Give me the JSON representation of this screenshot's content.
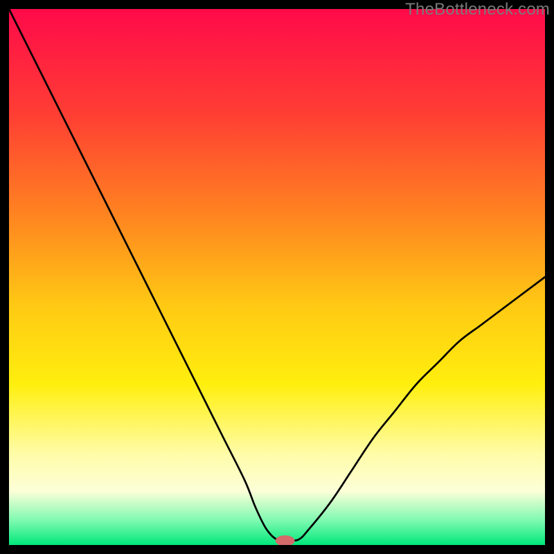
{
  "watermark": "TheBottleneck.com",
  "chart_data": {
    "type": "line",
    "title": "",
    "xlabel": "",
    "ylabel": "",
    "xlim": [
      0,
      100
    ],
    "ylim": [
      0,
      100
    ],
    "gradient_stops": [
      {
        "t": 0.0,
        "color": "#ff0a4a"
      },
      {
        "t": 0.2,
        "color": "#ff3f33"
      },
      {
        "t": 0.4,
        "color": "#ff8a1f"
      },
      {
        "t": 0.55,
        "color": "#ffc814"
      },
      {
        "t": 0.7,
        "color": "#ffef0e"
      },
      {
        "t": 0.83,
        "color": "#fffca8"
      },
      {
        "t": 0.9,
        "color": "#fcffd8"
      },
      {
        "t": 0.955,
        "color": "#7cf9b0"
      },
      {
        "t": 1.0,
        "color": "#00e87a"
      }
    ],
    "series": [
      {
        "name": "bottleneck-curve",
        "x": [
          0,
          4,
          8,
          12,
          16,
          20,
          24,
          28,
          32,
          36,
          40,
          44,
          46,
          48,
          50,
          52,
          54,
          56,
          60,
          64,
          68,
          72,
          76,
          80,
          84,
          88,
          92,
          96,
          100
        ],
        "y": [
          100,
          92,
          84,
          76,
          68,
          60,
          52,
          44,
          36,
          28,
          20,
          12,
          7,
          3,
          1,
          1,
          1,
          3,
          8,
          14,
          20,
          25,
          30,
          34,
          38,
          41,
          44,
          47,
          50
        ]
      }
    ],
    "marker": {
      "x": 51.5,
      "y": 0.8,
      "rx": 1.8,
      "ry": 1.0,
      "color": "#d46a6a"
    }
  }
}
